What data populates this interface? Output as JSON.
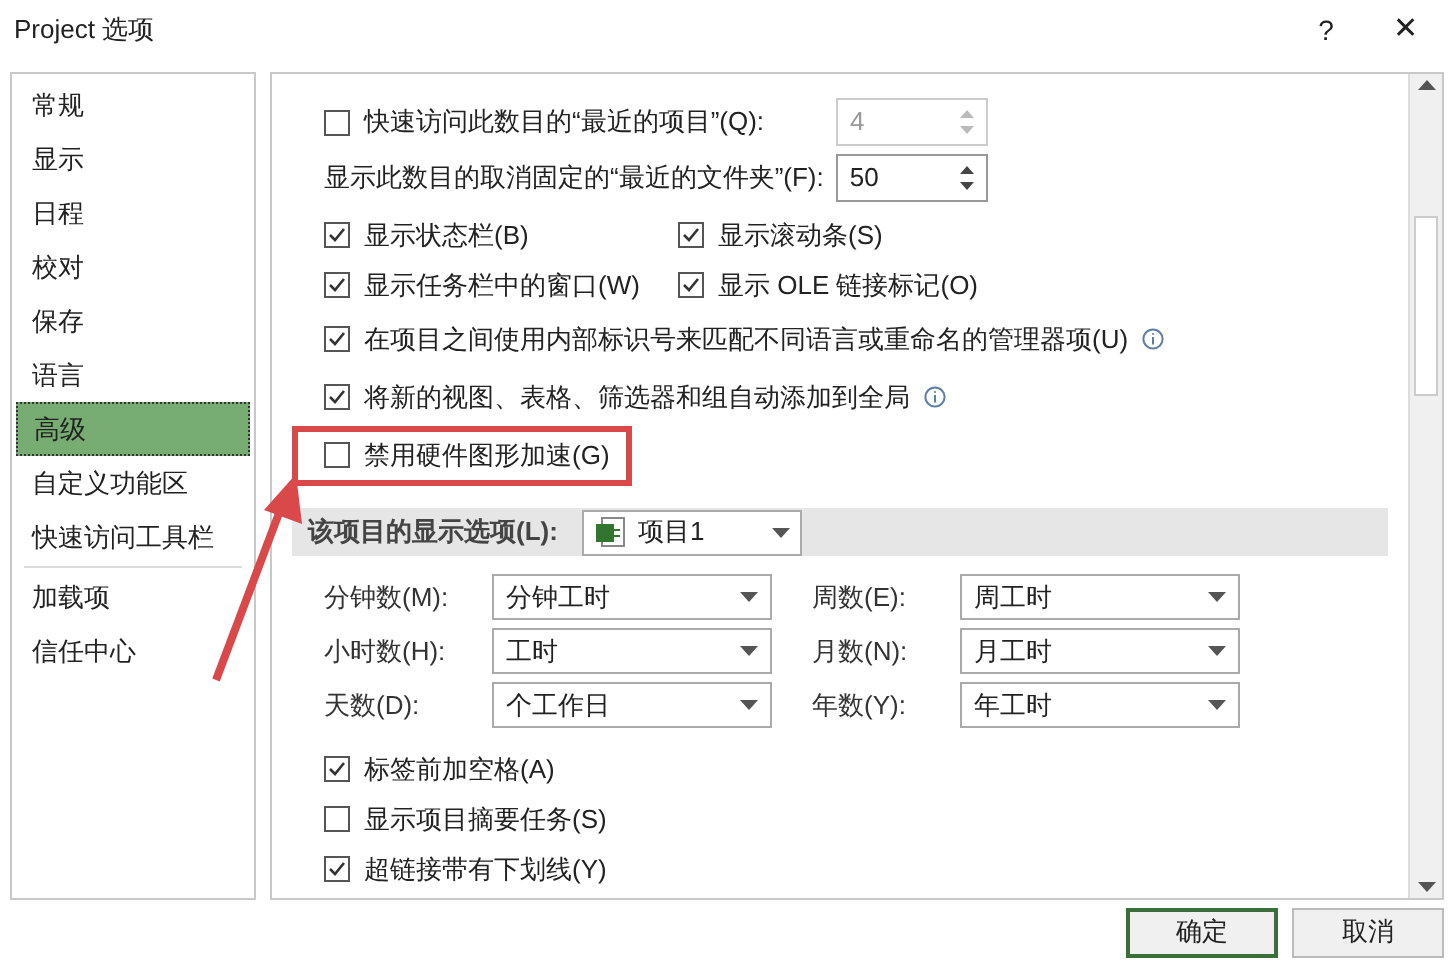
{
  "window": {
    "title": "Project 选项",
    "help": "?",
    "close": "✕"
  },
  "sidebar": {
    "items": [
      {
        "label": "常规",
        "selected": false
      },
      {
        "label": "显示",
        "selected": false
      },
      {
        "label": "日程",
        "selected": false
      },
      {
        "label": "校对",
        "selected": false
      },
      {
        "label": "保存",
        "selected": false
      },
      {
        "label": "语言",
        "selected": false
      },
      {
        "label": "高级",
        "selected": true
      },
      {
        "label": "自定义功能区",
        "selected": false
      },
      {
        "label": "快速访问工具栏",
        "selected": false,
        "divider_after": true
      },
      {
        "label": "加载项",
        "selected": false
      },
      {
        "label": "信任中心",
        "selected": false
      }
    ]
  },
  "options": [
    {
      "kind": "checkspin",
      "label": "快速访问此数目的“最近的项目”(Q):",
      "checked": false,
      "value": "4",
      "disabled": true
    },
    {
      "kind": "spin",
      "label": "显示此数目的取消固定的“最近的文件夹”(F):",
      "value": "50",
      "disabled": false
    },
    {
      "kind": "pair",
      "items": [
        {
          "label": "显示状态栏(B)",
          "checked": true
        },
        {
          "label": "显示滚动条(S)",
          "checked": true
        }
      ]
    },
    {
      "kind": "pair",
      "items": [
        {
          "label": "显示任务栏中的窗口(W)",
          "checked": true
        },
        {
          "label": "显示 OLE 链接标记(O)",
          "checked": true
        }
      ]
    },
    {
      "kind": "check",
      "label": "在项目之间使用内部标识号来匹配不同语言或重命名的管理器项(U)",
      "checked": true,
      "info": true
    },
    {
      "kind": "check",
      "label": "将新的视图、表格、筛选器和组自动添加到全局",
      "checked": true,
      "info": true
    },
    {
      "kind": "check",
      "label": "禁用硬件图形加速(G)",
      "checked": false,
      "info": false,
      "highlighted": true
    }
  ],
  "project_section": {
    "label": "该项目的显示选项(L):",
    "project": "项目1",
    "fields": [
      {
        "label": "分钟数(M):",
        "value": "分钟工时"
      },
      {
        "label": "周数(E):",
        "value": "周工时"
      },
      {
        "label": "小时数(H):",
        "value": "工时"
      },
      {
        "label": "月数(N):",
        "value": "月工时"
      },
      {
        "label": "天数(D):",
        "value": "个工作日"
      },
      {
        "label": "年数(Y):",
        "value": "年工时"
      }
    ],
    "checks": [
      {
        "label": "标签前加空格(A)",
        "checked": true
      },
      {
        "label": "显示项目摘要任务(S)",
        "checked": false
      },
      {
        "label": "超链接带有下划线(Y)",
        "checked": true
      }
    ]
  },
  "buttons": [
    {
      "label": "确定",
      "default": true
    },
    {
      "label": "取消",
      "default": false
    }
  ]
}
